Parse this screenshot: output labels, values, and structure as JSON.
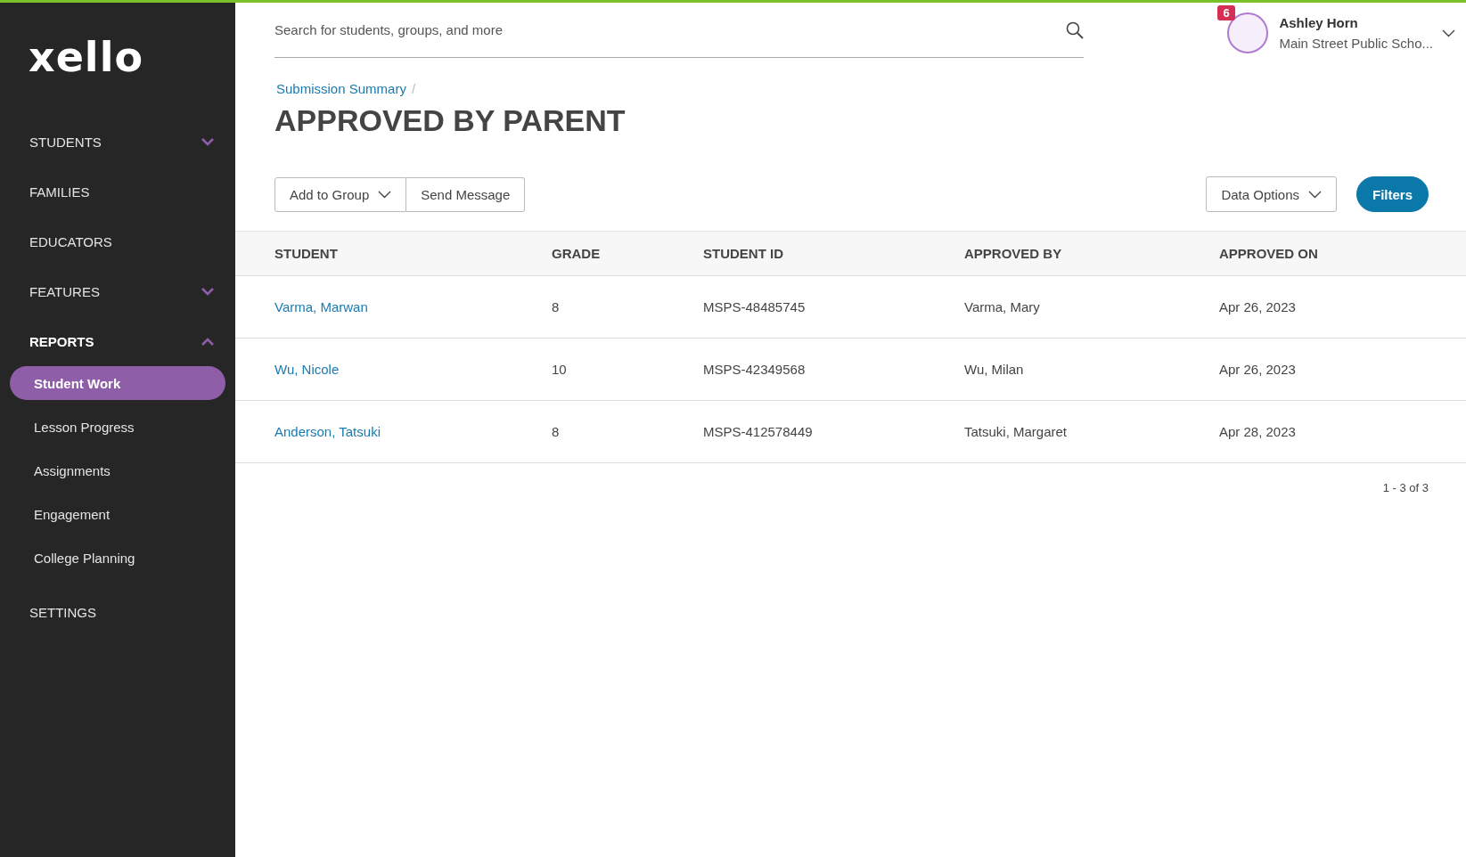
{
  "logo": {
    "text": "xello"
  },
  "sidebar": {
    "items": [
      {
        "label": "STUDENTS",
        "expanded": false,
        "selected": false
      },
      {
        "label": "FAMILIES",
        "selected": false
      },
      {
        "label": "EDUCATORS",
        "selected": false
      },
      {
        "label": "FEATURES",
        "expanded": false,
        "selected": false
      },
      {
        "label": "REPORTS",
        "expanded": true,
        "selected": true,
        "children": [
          {
            "label": "Student Work",
            "selected": true
          },
          {
            "label": "Lesson Progress",
            "selected": false
          },
          {
            "label": "Assignments",
            "selected": false
          },
          {
            "label": "Engagement",
            "selected": false
          },
          {
            "label": "College Planning",
            "selected": false
          }
        ]
      },
      {
        "label": "SETTINGS",
        "selected": false
      }
    ]
  },
  "header": {
    "search": {
      "placeholder": "Search for students, groups, and more"
    },
    "user": {
      "name": "Ashley Horn",
      "school": "Main Street Public Scho...",
      "notifications": "6"
    }
  },
  "breadcrumb": {
    "items": [
      "Submission Summary"
    ],
    "separator": "/"
  },
  "title": "APPROVED BY PARENT",
  "toolbar": {
    "left": [
      {
        "label": "Add to Group",
        "kind": "dropdown"
      },
      {
        "label": "Send Message",
        "kind": "plain"
      }
    ],
    "right": [
      {
        "label": "Data Options",
        "kind": "dropdown"
      },
      {
        "label": "Filters",
        "kind": "primary"
      }
    ]
  },
  "table": {
    "columns": [
      "STUDENT",
      "GRADE",
      "STUDENT ID",
      "APPROVED BY",
      "APPROVED ON"
    ],
    "rows": [
      {
        "student": "Varma, Marwan",
        "grade": "8",
        "student_id": "MSPS-48485745",
        "approved_by": "Varma, Mary",
        "approved_on": "Apr 26, 2023"
      },
      {
        "student": "Wu, Nicole",
        "grade": "10",
        "student_id": "MSPS-42349568",
        "approved_by": "Wu, Milan",
        "approved_on": "Apr 26, 2023"
      },
      {
        "student": "Anderson, Tatsuki",
        "grade": "8",
        "student_id": "MSPS-412578449",
        "approved_by": "Tatsuki, Margaret",
        "approved_on": "Apr 28, 2023"
      }
    ]
  },
  "pagination": "1 - 3 of 3"
}
